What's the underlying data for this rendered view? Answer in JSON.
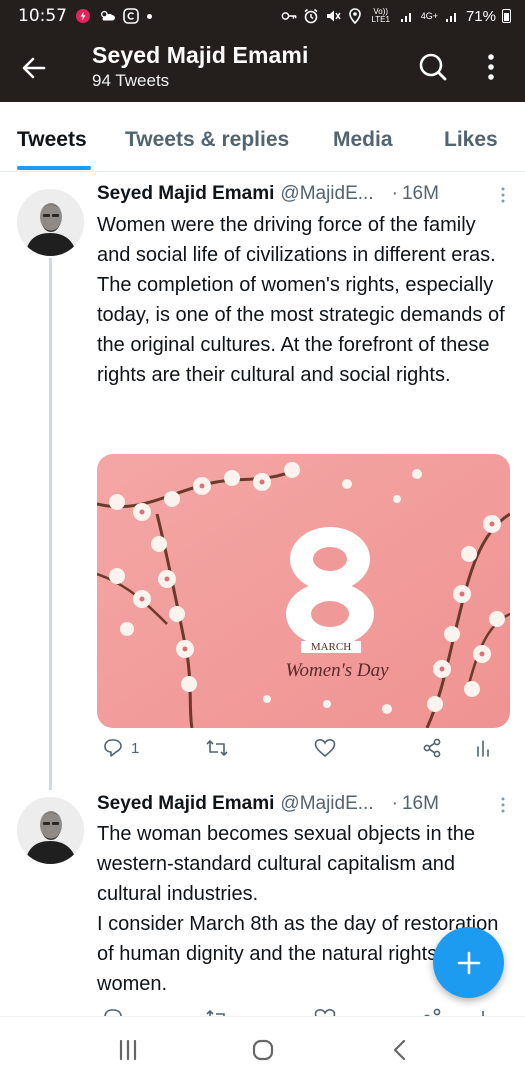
{
  "status_bar": {
    "time": "10:57",
    "battery": "71%",
    "network_label": "Vo)) LTE1",
    "network2_label": "4G+"
  },
  "header": {
    "name": "Seyed Majid Emami",
    "tweet_count": "94 Tweets"
  },
  "tabs": [
    {
      "label": "Tweets",
      "active": true
    },
    {
      "label": "Tweets & replies",
      "active": false
    },
    {
      "label": "Media",
      "active": false
    },
    {
      "label": "Likes",
      "active": false
    }
  ],
  "tweets": [
    {
      "author": "Seyed Majid Emami",
      "handle": "@MajidE...",
      "time": "16M",
      "separator": "·",
      "text": "Women were the driving force of the family and social life of civilizations in different eras. The completion of women's rights, especially today, is one of the most strategic demands of the original cultures. At the forefront of these rights are their cultural and social rights.",
      "media": {
        "number": "8",
        "month": "MARCH",
        "caption": "Women's Day"
      },
      "reply_count": "1"
    },
    {
      "author": "Seyed Majid Emami",
      "handle": "@MajidE...",
      "time": "16M",
      "separator": "·",
      "text": "The woman becomes sexual objects in the western-standard cultural capitalism and cultural industries.\nI consider March 8th as the day of restoration of human dignity and the natural rights of women."
    }
  ],
  "colors": {
    "header_bg": "#241f1c",
    "accent": "#1d9bf0",
    "secondary_text": "#536471",
    "media_bg": "#f2a0a0"
  },
  "icons": [
    "back-arrow-icon",
    "search-icon",
    "more-vertical-icon",
    "reply-icon",
    "retweet-icon",
    "like-icon",
    "share-icon",
    "analytics-icon",
    "compose-plus-icon",
    "recents-icon",
    "home-icon",
    "back-nav-icon"
  ]
}
